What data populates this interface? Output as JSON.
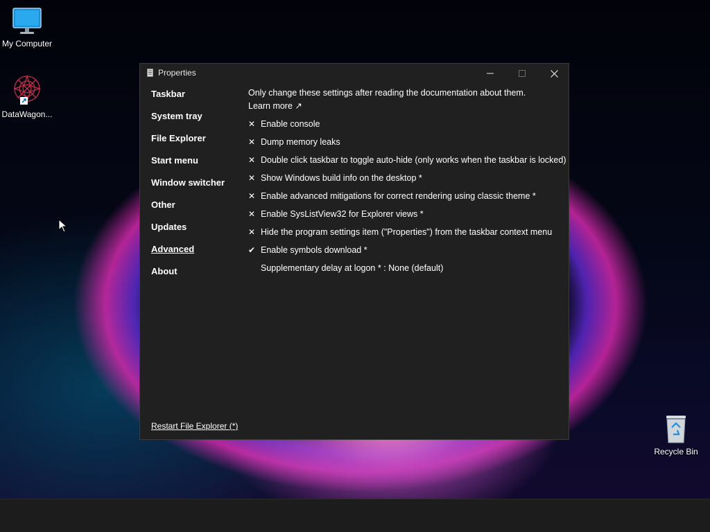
{
  "desktop": {
    "icons": [
      {
        "label": "My Computer",
        "icon": "monitor-icon"
      },
      {
        "label": "DataWagon...",
        "icon": "datawagon-icon"
      },
      {
        "label": "Recycle Bin",
        "icon": "recycle-bin-icon"
      }
    ]
  },
  "window": {
    "title": "Properties",
    "controls": {
      "minimize": "minimize-icon",
      "maximize": "maximize-icon",
      "close": "close-icon"
    },
    "nav": [
      {
        "label": "Taskbar",
        "active": false
      },
      {
        "label": "System tray",
        "active": false
      },
      {
        "label": "File Explorer",
        "active": false
      },
      {
        "label": "Start menu",
        "active": false
      },
      {
        "label": "Window switcher",
        "active": false
      },
      {
        "label": "Other",
        "active": false
      },
      {
        "label": "Updates",
        "active": false
      },
      {
        "label": "Advanced",
        "active": true
      },
      {
        "label": "About",
        "active": false
      }
    ],
    "notice": "Only change these settings after reading the documentation about them.",
    "learn_more": "Learn more ↗",
    "options": [
      {
        "mark": "✕",
        "label": "Enable console"
      },
      {
        "mark": "✕",
        "label": "Dump memory leaks"
      },
      {
        "mark": "✕",
        "label": "Double click taskbar to toggle auto-hide (only works when the taskbar is locked)"
      },
      {
        "mark": "✕",
        "label": "Show Windows build info on the desktop *"
      },
      {
        "mark": "✕",
        "label": "Enable advanced mitigations for correct rendering using classic theme *"
      },
      {
        "mark": "✕",
        "label": "Enable SysListView32 for Explorer views *"
      },
      {
        "mark": "✕",
        "label": "Hide the program settings item (\"Properties\") from the taskbar context menu"
      },
      {
        "mark": "✔",
        "label": "Enable symbols download *"
      },
      {
        "mark": "",
        "label": "Supplementary delay at logon * : None (default)"
      }
    ],
    "footer_link": "Restart File Explorer (*)"
  }
}
